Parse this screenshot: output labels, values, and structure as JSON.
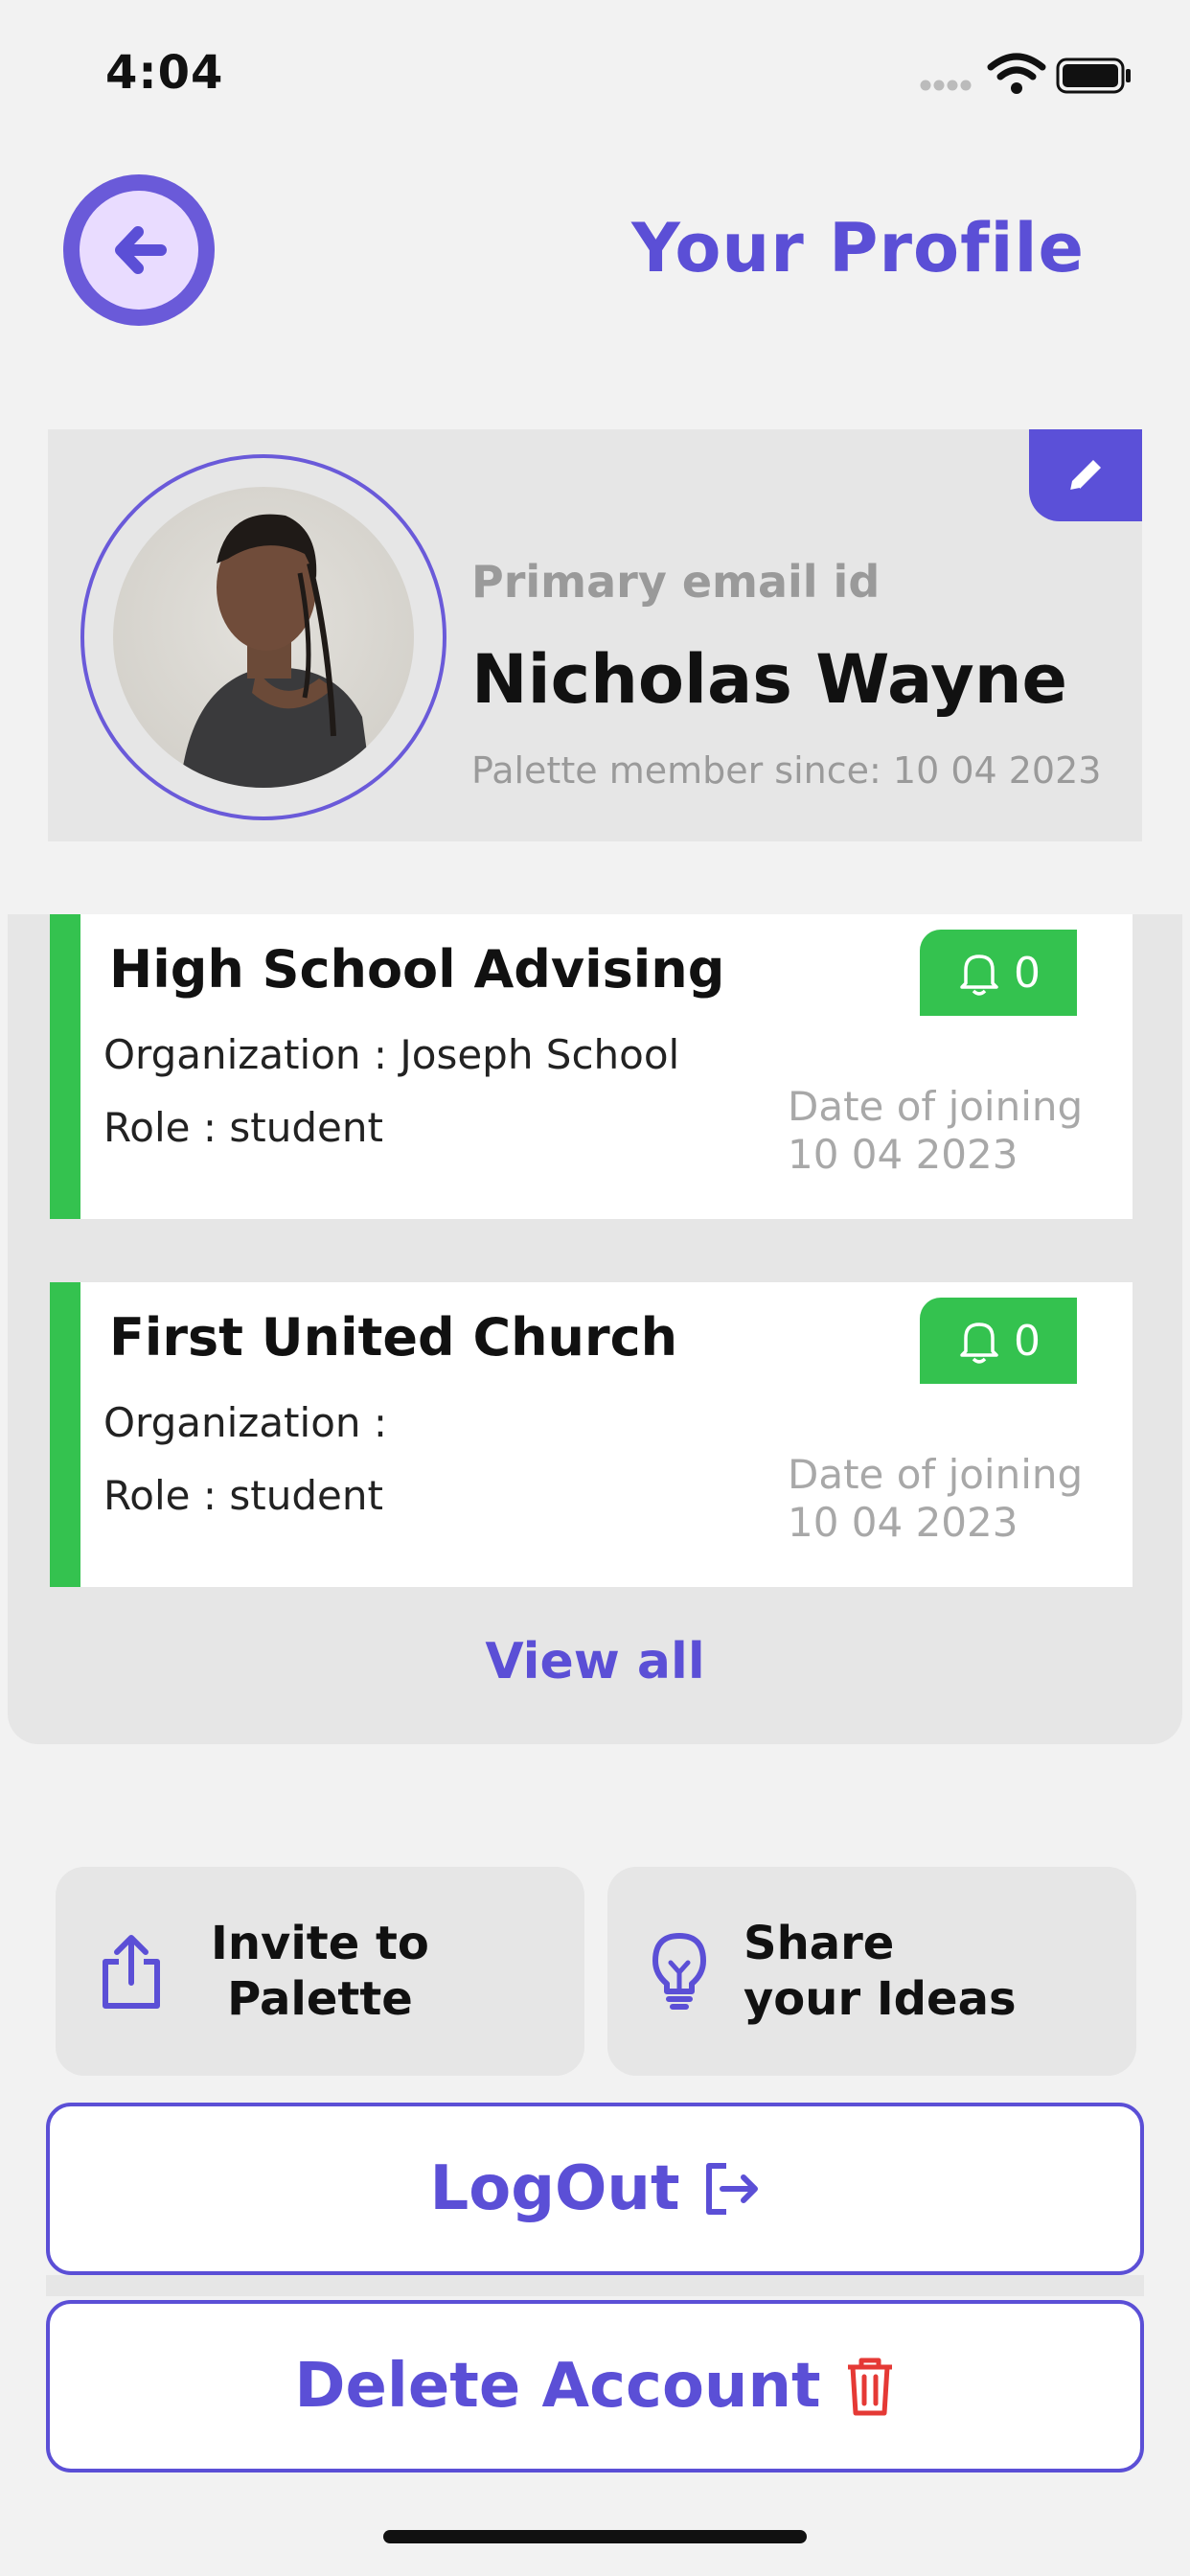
{
  "status_bar": {
    "time": "4:04"
  },
  "header": {
    "title": "Your Profile",
    "back_icon": "arrow-left-icon"
  },
  "profile": {
    "email_label": "Primary email id",
    "name": "Nicholas Wayne",
    "member_since": "Palette member since: 10 04 2023",
    "edit_icon": "pencil-icon"
  },
  "groups": [
    {
      "title": "High School Advising",
      "organization": "Organization : Joseph School",
      "role": "Role : student",
      "join_label": "Date of joining",
      "join_date": "10 04 2023",
      "notifications": "0"
    },
    {
      "title": "First United Church",
      "organization": "Organization :",
      "role": "Role : student",
      "join_label": "Date of joining",
      "join_date": "10 04 2023",
      "notifications": "0"
    }
  ],
  "view_all": "View all",
  "actions": {
    "invite_line1": "Invite to",
    "invite_line2": "Palette",
    "ideas_line1": "Share",
    "ideas_line2": "your Ideas"
  },
  "buttons": {
    "logout": "LogOut",
    "delete": "Delete Account"
  },
  "colors": {
    "accent": "#5b4fd6",
    "success": "#34c24f",
    "danger": "#e53935"
  }
}
